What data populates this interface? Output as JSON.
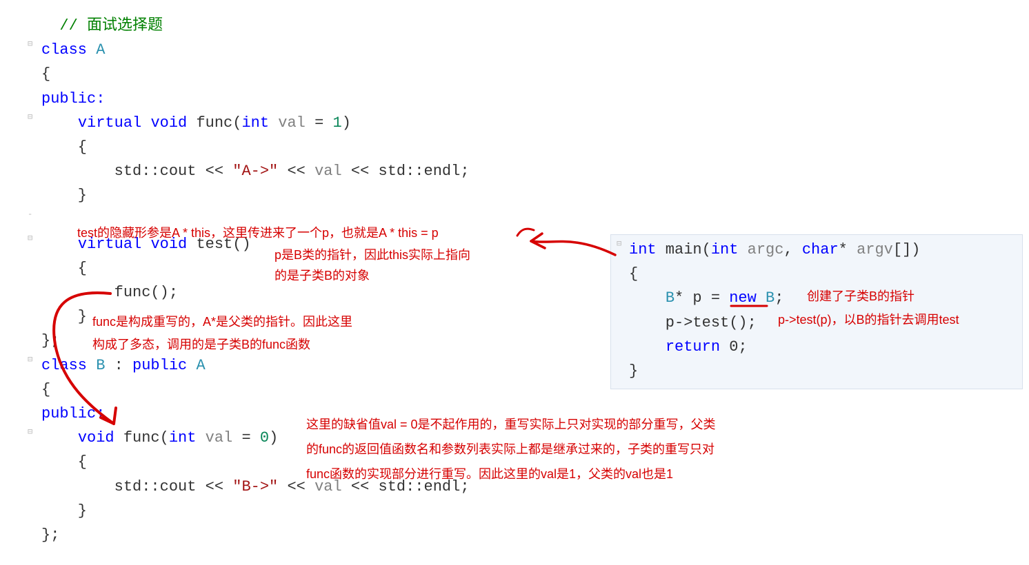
{
  "left": {
    "l1": "// 面试选择题",
    "l2a": "class",
    "l2b": "A",
    "l3": "{",
    "l4a": "public",
    "l4b": ":",
    "l5a": "virtual",
    "l5b": "void",
    "l5c": " func(",
    "l5d": "int",
    "l5e": "val",
    "l5f": " = ",
    "l5g": "1",
    "l5h": ")",
    "l6": "    {",
    "l7a": "        std::cout << ",
    "l7b": "\"A->\"",
    "l7c": " << ",
    "l7d": "val",
    "l7e": " << std::endl;",
    "l8": "    }",
    "l10a": "virtual",
    "l10b": "void",
    "l10c": " test()",
    "l11": "    {",
    "l12": "        func();",
    "l13": "    }",
    "l14": "};",
    "l15a": "class",
    "l15b": "B",
    "l15c": " : ",
    "l15d": "public",
    "l15e": "A",
    "l16": "{",
    "l17a": "public",
    "l17b": ":",
    "l18a": "void",
    "l18b": " func(",
    "l18c": "int",
    "l18d": "val",
    "l18e": " = ",
    "l18f": "0",
    "l18g": ")",
    "l19": "    {",
    "l20a": "        std::cout << ",
    "l20b": "\"B->\"",
    "l20c": " << ",
    "l20d": "val",
    "l20e": " << std::endl;",
    "l21": "    }",
    "l22": "};"
  },
  "main": {
    "m1a": "int",
    "m1b": " main(",
    "m1c": "int",
    "m1d": "argc",
    "m1e": ", ",
    "m1f": "char",
    "m1g": "* ",
    "m1h": "argv",
    "m1i": "[])",
    "m2": "{",
    "m3a": "    ",
    "m3b": "B",
    "m3c": "* p = ",
    "m3d": "new",
    "m3e": "B",
    "m3f": ";",
    "m4": "    p->test();",
    "m5a": "    ",
    "m5b": "return",
    "m5c": " 0;",
    "m6": "}"
  },
  "anno": {
    "a1": "test的隐藏形参是A * this，这里传进来了一个p，也就是A * this = p",
    "a2": "p是B类的指针，因此this实际上指向",
    "a3": "的是子类B的对象",
    "a4": "func是构成重写的，A*是父类的指针。因此这里",
    "a5": "构成了多态，调用的是子类B的func函数",
    "a6": "这里的缺省值val = 0是不起作用的，重写实际上只对实现的部分重写，父类",
    "a7": "的func的返回值函数名和参数列表实际上都是继承过来的，子类的重写只对",
    "a8": "func函数的实现部分进行重写。因此这里的val是1，父类的val也是1",
    "a9": "创建了子类B的指针",
    "a10": "p->test(p)，以B的指针去调用test"
  }
}
